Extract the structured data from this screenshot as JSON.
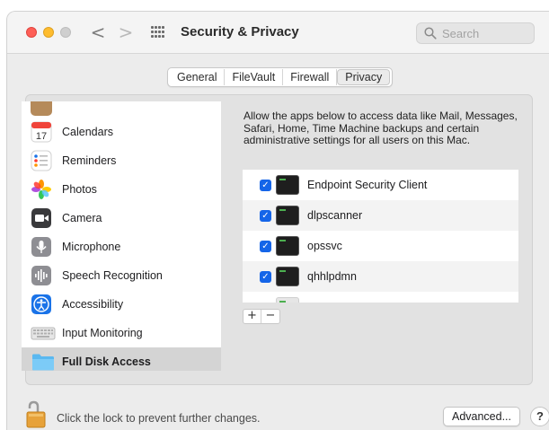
{
  "window": {
    "title": "Security & Privacy",
    "traffic_lights": [
      "close",
      "minimize",
      "zoom"
    ]
  },
  "toolbar": {
    "back_glyph": "<",
    "forward_glyph": ">",
    "search_placeholder": "Search"
  },
  "tabs": [
    {
      "label": "General",
      "selected": false
    },
    {
      "label": "FileVault",
      "selected": false
    },
    {
      "label": "Firewall",
      "selected": false
    },
    {
      "label": "Privacy",
      "selected": true
    }
  ],
  "sidebar": {
    "items": [
      {
        "label": "",
        "icon": "contacts-icon",
        "color": "#b58a5a",
        "selected": false
      },
      {
        "label": "Calendars",
        "icon": "calendar-icon",
        "color": "#ffffff",
        "badge": "17",
        "selected": false
      },
      {
        "label": "Reminders",
        "icon": "reminders-icon",
        "color": "#ffffff",
        "selected": false
      },
      {
        "label": "Photos",
        "icon": "photos-icon",
        "color": "#ffffff",
        "selected": false
      },
      {
        "label": "Camera",
        "icon": "camera-icon",
        "color": "#2f2f2f",
        "selected": false
      },
      {
        "label": "Microphone",
        "icon": "microphone-icon",
        "color": "#8e8e93",
        "selected": false
      },
      {
        "label": "Speech Recognition",
        "icon": "speech-recognition-icon",
        "color": "#8e8e93",
        "selected": false
      },
      {
        "label": "Accessibility",
        "icon": "accessibility-icon",
        "color": "#1a73e8",
        "selected": false
      },
      {
        "label": "Input Monitoring",
        "icon": "keyboard-icon",
        "color": "#d9d9d9",
        "selected": false
      },
      {
        "label": "Full Disk Access",
        "icon": "folder-icon",
        "color": "#5ab8f0",
        "selected": true
      }
    ]
  },
  "main": {
    "description": "Allow the apps below to access data like Mail, Messages, Safari, Home, Time Machine backups and certain administrative settings for all users on this Mac.",
    "apps": [
      {
        "name": "Endpoint Security Client",
        "checked": true
      },
      {
        "name": "dlpscanner",
        "checked": true
      },
      {
        "name": "opssvc",
        "checked": true
      },
      {
        "name": "qhhlpdmn",
        "checked": true
      }
    ],
    "add_label": "+",
    "remove_label": "−"
  },
  "footer": {
    "lock_text": "Click the lock to prevent further changes.",
    "advanced_label": "Advanced...",
    "help_label": "?"
  },
  "colors": {
    "accent": "#1565e8",
    "selected_row": "#d4d4d4"
  }
}
